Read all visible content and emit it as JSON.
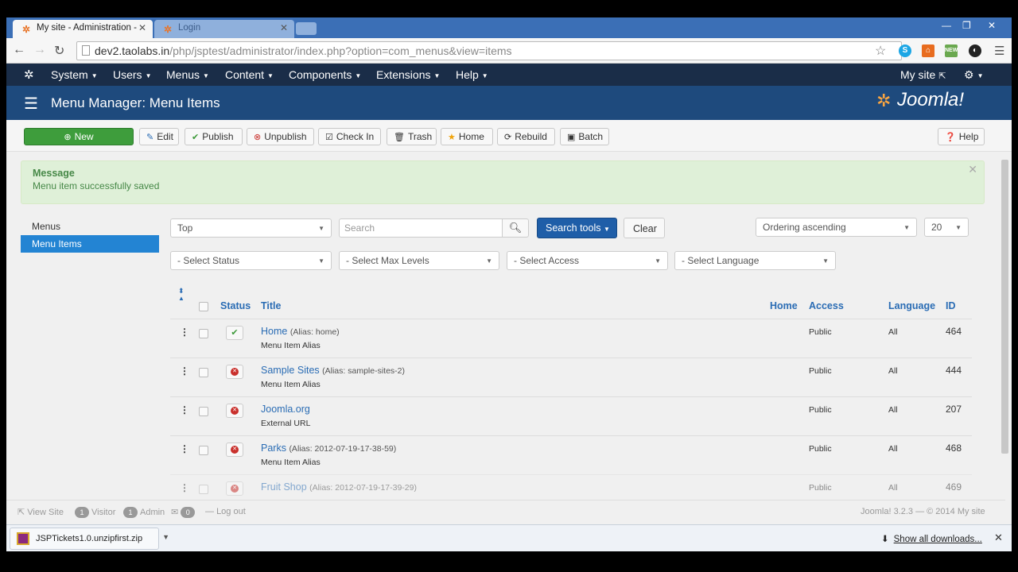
{
  "browser": {
    "tabs": [
      {
        "label": "My site - Administration -",
        "active": true,
        "icon": "joomla-favicon"
      },
      {
        "label": "Login",
        "active": false,
        "icon": "joomla-favicon"
      }
    ],
    "url_host": "dev2.taolabs.in",
    "url_path": "/php/jsptest/administrator/index.php?option=com_menus&view=items",
    "ext_badge": "NEW"
  },
  "jnav": {
    "items": [
      "System",
      "Users",
      "Menus",
      "Content",
      "Components",
      "Extensions",
      "Help"
    ],
    "mysite": "My site"
  },
  "header": {
    "title": "Menu Manager: Menu Items",
    "brand": "Joomla!"
  },
  "toolbar": {
    "new": "New",
    "edit": "Edit",
    "publish": "Publish",
    "unpublish": "Unpublish",
    "checkin": "Check In",
    "trash": "Trash",
    "home": "Home",
    "rebuild": "Rebuild",
    "batch": "Batch",
    "help": "Help"
  },
  "message": {
    "heading": "Message",
    "text": "Menu item successfully saved"
  },
  "sidebar": {
    "items": [
      {
        "label": "Menus",
        "active": false
      },
      {
        "label": "Menu Items",
        "active": true
      }
    ]
  },
  "filters": {
    "menu": "Top",
    "search_placeholder": "Search",
    "search_tools": "Search tools",
    "clear": "Clear",
    "ordering": "Ordering ascending",
    "limit": "20",
    "status": "- Select Status",
    "max_levels": "- Select Max Levels",
    "access": "- Select Access",
    "language": "- Select Language"
  },
  "table": {
    "headers": {
      "status": "Status",
      "title": "Title",
      "home": "Home",
      "access": "Access",
      "language": "Language",
      "id": "ID"
    },
    "rows": [
      {
        "title": "Home",
        "alias": "(Alias: home)",
        "type": "Menu Item Alias",
        "published": true,
        "access": "Public",
        "language": "All",
        "id": "464"
      },
      {
        "title": "Sample Sites",
        "alias": "(Alias: sample-sites-2)",
        "type": "Menu Item Alias",
        "published": false,
        "access": "Public",
        "language": "All",
        "id": "444"
      },
      {
        "title": "Joomla.org",
        "alias": "",
        "type": "External URL",
        "published": false,
        "access": "Public",
        "language": "All",
        "id": "207"
      },
      {
        "title": "Parks",
        "alias": "(Alias: 2012-07-19-17-38-59)",
        "type": "Menu Item Alias",
        "published": false,
        "access": "Public",
        "language": "All",
        "id": "468"
      },
      {
        "title": "Fruit Shop",
        "alias": "(Alias: 2012-07-19-17-39-29)",
        "type": "",
        "published": false,
        "access": "Public",
        "language": "All",
        "id": "469"
      }
    ]
  },
  "footer": {
    "view_site": "View Site",
    "visitors_count": "1",
    "visitor": "Visitor",
    "admins_count": "1",
    "admin": "Admin",
    "messages_count": "0",
    "logout": "Log out",
    "copyright": "Joomla! 3.2.3 — © 2014 My site"
  },
  "downloads": {
    "file": "JSPTickets1.0.unzipfirst.zip",
    "show_all": "Show all downloads..."
  }
}
